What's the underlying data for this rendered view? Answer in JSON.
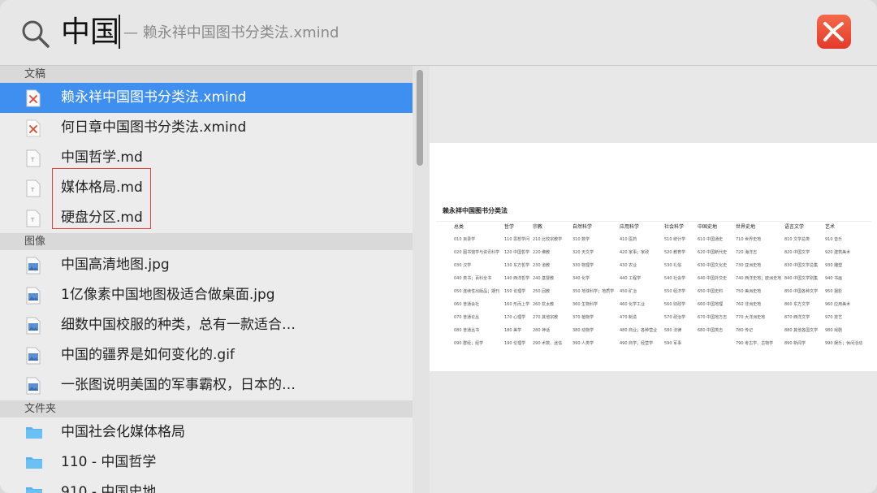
{
  "search": {
    "query": "中国",
    "hint": "— 赖永祥中国图书分类法.xmind"
  },
  "sections": {
    "documents": "文稿",
    "images": "图像",
    "folders": "文件夹"
  },
  "documents": [
    {
      "label": "赖永祥中国图书分类法.xmind",
      "icon": "xmind-file-icon",
      "selected": true
    },
    {
      "label": "何日章中国图书分类法.xmind",
      "icon": "xmind-file-icon"
    },
    {
      "label": "中国哲学.md",
      "icon": "text-file-icon"
    },
    {
      "label": "媒体格局.md",
      "icon": "text-file-icon"
    },
    {
      "label": "硬盘分区.md",
      "icon": "text-file-icon"
    }
  ],
  "images": [
    {
      "label": "中国高清地图.jpg",
      "icon": "image-file-icon"
    },
    {
      "label": "1亿像素中国地图极适合做桌面.jpg",
      "icon": "image-file-icon"
    },
    {
      "label": "细数中国校服的种类，总有一款适合…",
      "icon": "image-file-icon"
    },
    {
      "label": "中国的疆界是如何变化的.gif",
      "icon": "image-file-icon"
    },
    {
      "label": "一张图说明美国的军事霸权，日本的…",
      "icon": "image-file-icon"
    }
  ],
  "folders": [
    {
      "label": "中国社会化媒体格局",
      "icon": "folder-icon"
    },
    {
      "label": "110 - 中国哲学",
      "icon": "folder-icon"
    },
    {
      "label": "910 - 中国史地",
      "icon": "folder-icon"
    }
  ],
  "preview": {
    "title": "赖永祥中国图书分类法",
    "columns": [
      {
        "head": "总类",
        "cells": [
          "010 目录学",
          "020 图书馆学与资讯科学",
          "030 汉学",
          "040 类书；百科全书",
          "050 连续性出版品；期刊",
          "060 普通会社",
          "070 普通论丛",
          "080 普通丛书",
          "090 群经；经学"
        ]
      },
      {
        "head": "哲学",
        "cells": [
          "110 思想学问",
          "120 中国哲学",
          "130 东方哲学",
          "140 西洋哲学",
          "150 论理学",
          "160 形而上学",
          "170 心理学",
          "180 美学",
          "190 伦理学"
        ]
      },
      {
        "head": "宗教",
        "cells": [
          "210 比较宗教学",
          "220 佛教",
          "230 道教",
          "240 基督教",
          "250 回教",
          "260 犹太教",
          "270 其他宗教",
          "280 神话",
          "290 术数、迷信"
        ]
      },
      {
        "head": "自然科学",
        "cells": [
          "310 数学",
          "320 天文学",
          "330 物理学",
          "340 化学",
          "350 地球科学；地质学",
          "360 生物科学",
          "370 植物学",
          "380 动物学",
          "390 人类学"
        ]
      },
      {
        "head": "应用科学",
        "cells": [
          "410 医药",
          "420 家事；家政",
          "430 农业",
          "440 工程学",
          "450 矿冶",
          "460 化学工业",
          "470 制造",
          "480 商业；各种营业",
          "490 商学；经营学"
        ]
      },
      {
        "head": "社会科学",
        "cells": [
          "510 统计学",
          "520 教育学",
          "530 礼俗",
          "540 社会学",
          "550 经济学",
          "560 财政学",
          "570 政治学",
          "580 法律",
          "590 军事"
        ]
      },
      {
        "head": "中国史地",
        "cells": [
          "610 中国通史",
          "620 中国断代史",
          "630 中国文化史",
          "640 中国外交史",
          "650 中国史料",
          "660 中国地理",
          "670 中国地方志",
          "680 中国类志"
        ]
      },
      {
        "head": "世界史地",
        "cells": [
          "710 世界史地",
          "720 海洋志",
          "730 亚洲史地",
          "740 西洋史地；欧洲史地",
          "750 美洲史地",
          "760 非洲史地",
          "770 大洋洲史地",
          "780 传记",
          "790 考古学、古物学"
        ]
      },
      {
        "head": "语言文学",
        "cells": [
          "810 文学总类",
          "820 中国文学",
          "830 中国文学总集",
          "840 中国文学别集",
          "850 中国各种文学",
          "860 东方文学",
          "870 西洋文学",
          "880 其他各国文学",
          "890 新闻学"
        ]
      },
      {
        "head": "艺术",
        "cells": [
          "910 音乐",
          "920 建筑美术",
          "930 雕塑",
          "940 书画",
          "950 摄影",
          "960 应用美术",
          "970 技艺",
          "980 戏剧",
          "990 娱乐；休闲活动"
        ]
      }
    ]
  }
}
